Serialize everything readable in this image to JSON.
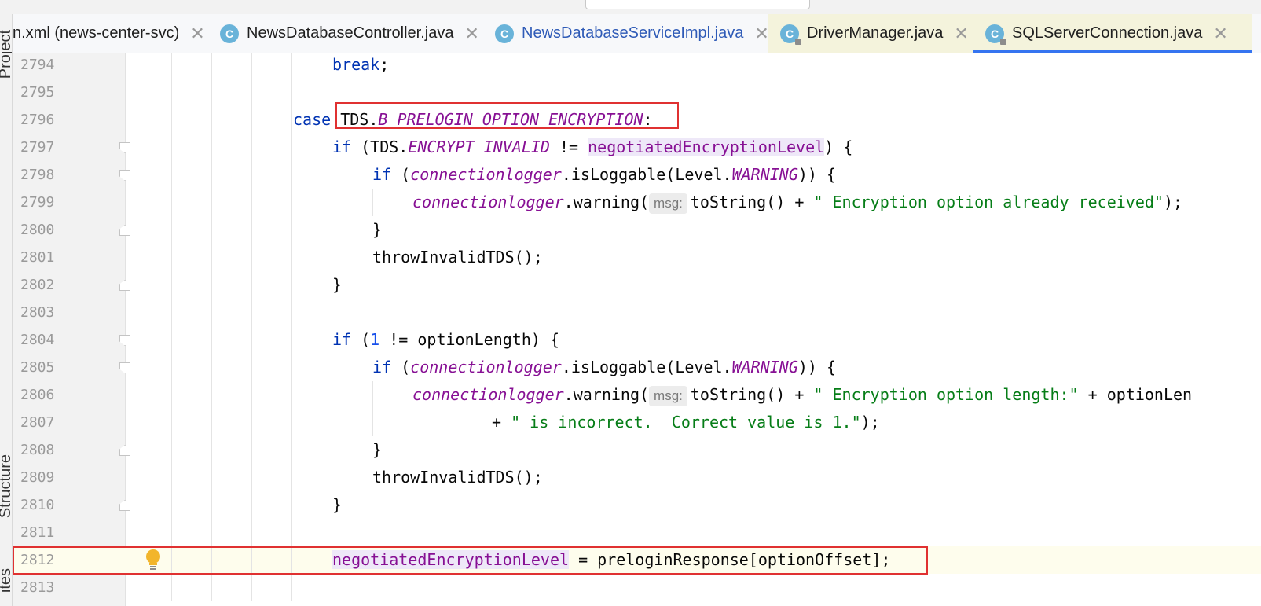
{
  "tabs": [
    {
      "label": "n.xml (news-center-svc)",
      "icon": "maven-file-icon",
      "modified": false,
      "active": false
    },
    {
      "label": "NewsDatabaseController.java",
      "icon": "java-class-icon",
      "modified": false,
      "active": false
    },
    {
      "label": "NewsDatabaseServiceImpl.java",
      "icon": "java-class-icon",
      "modified": true,
      "active": false
    },
    {
      "label": "DriverManager.java",
      "icon": "java-class-locked-icon",
      "modified": false,
      "active": false
    },
    {
      "label": "SQLServerConnection.java",
      "icon": "java-class-locked-icon",
      "modified": false,
      "active": true
    }
  ],
  "tab_icon_letter": "C",
  "tool_windows": {
    "project": "Project",
    "structure": "Structure",
    "favorites": "ites"
  },
  "lines": [
    {
      "num": "2794",
      "t": [
        {
          "text": "break",
          "c": "kw"
        },
        {
          "text": ";"
        }
      ]
    },
    {
      "num": "2795",
      "t": []
    },
    {
      "num": "2796",
      "t": [
        {
          "text": "case ",
          "c": "kw"
        },
        {
          "text": "TDS."
        },
        {
          "text": "B_PRELOGIN_OPTION_ENCRYPTION",
          "c": "fld"
        },
        {
          "text": ":"
        }
      ]
    },
    {
      "num": "2797",
      "t": [
        {
          "text": "if ",
          "c": "kw"
        },
        {
          "text": "(TDS."
        },
        {
          "text": "ENCRYPT_INVALID",
          "c": "fld"
        },
        {
          "text": " != "
        },
        {
          "text": "negotiatedEncryptionLevel",
          "c": "mbr usage-hl"
        },
        {
          "text": ") {"
        }
      ]
    },
    {
      "num": "2798",
      "t": [
        {
          "text": "if ",
          "c": "kw"
        },
        {
          "text": "("
        },
        {
          "text": "connectionlogger",
          "c": "fld"
        },
        {
          "text": ".isLoggable(Level."
        },
        {
          "text": "WARNING",
          "c": "fld"
        },
        {
          "text": ")) {"
        }
      ]
    },
    {
      "num": "2799",
      "t": [
        {
          "text": "connectionlogger",
          "c": "fld"
        },
        {
          "text": ".warning("
        },
        {
          "text": "msg:",
          "c": "hint"
        },
        {
          "text": "toString() + "
        },
        {
          "text": "\" Encryption option already received\"",
          "c": "str"
        },
        {
          "text": ");"
        }
      ]
    },
    {
      "num": "2800",
      "t": [
        {
          "text": "}"
        }
      ]
    },
    {
      "num": "2801",
      "t": [
        {
          "text": "throwInvalidTDS();"
        }
      ]
    },
    {
      "num": "2802",
      "t": [
        {
          "text": "}"
        }
      ]
    },
    {
      "num": "2803",
      "t": []
    },
    {
      "num": "2804",
      "t": [
        {
          "text": "if ",
          "c": "kw"
        },
        {
          "text": "("
        },
        {
          "text": "1",
          "c": "num"
        },
        {
          "text": " != optionLength) {"
        }
      ]
    },
    {
      "num": "2805",
      "t": [
        {
          "text": "if ",
          "c": "kw"
        },
        {
          "text": "("
        },
        {
          "text": "connectionlogger",
          "c": "fld"
        },
        {
          "text": ".isLoggable(Level."
        },
        {
          "text": "WARNING",
          "c": "fld"
        },
        {
          "text": ")) {"
        }
      ]
    },
    {
      "num": "2806",
      "t": [
        {
          "text": "connectionlogger",
          "c": "fld"
        },
        {
          "text": ".warning("
        },
        {
          "text": "msg:",
          "c": "hint"
        },
        {
          "text": "toString() + "
        },
        {
          "text": "\" Encryption option length:\"",
          "c": "str"
        },
        {
          "text": " + optionLen"
        }
      ]
    },
    {
      "num": "2807",
      "t": [
        {
          "text": "+ "
        },
        {
          "text": "\" is incorrect.  Correct value is 1.\"",
          "c": "str"
        },
        {
          "text": ");"
        }
      ]
    },
    {
      "num": "2808",
      "t": [
        {
          "text": "}"
        }
      ]
    },
    {
      "num": "2809",
      "t": [
        {
          "text": "throwInvalidTDS();"
        }
      ]
    },
    {
      "num": "2810",
      "t": [
        {
          "text": "}"
        }
      ]
    },
    {
      "num": "2811",
      "t": []
    },
    {
      "num": "2812",
      "t": [
        {
          "text": "negotiatedEncryptionLevel",
          "c": "mbr usage-hl"
        },
        {
          "text": " = preloginResponse[optionOffset];"
        }
      ]
    },
    {
      "num": "2813",
      "t": []
    }
  ]
}
